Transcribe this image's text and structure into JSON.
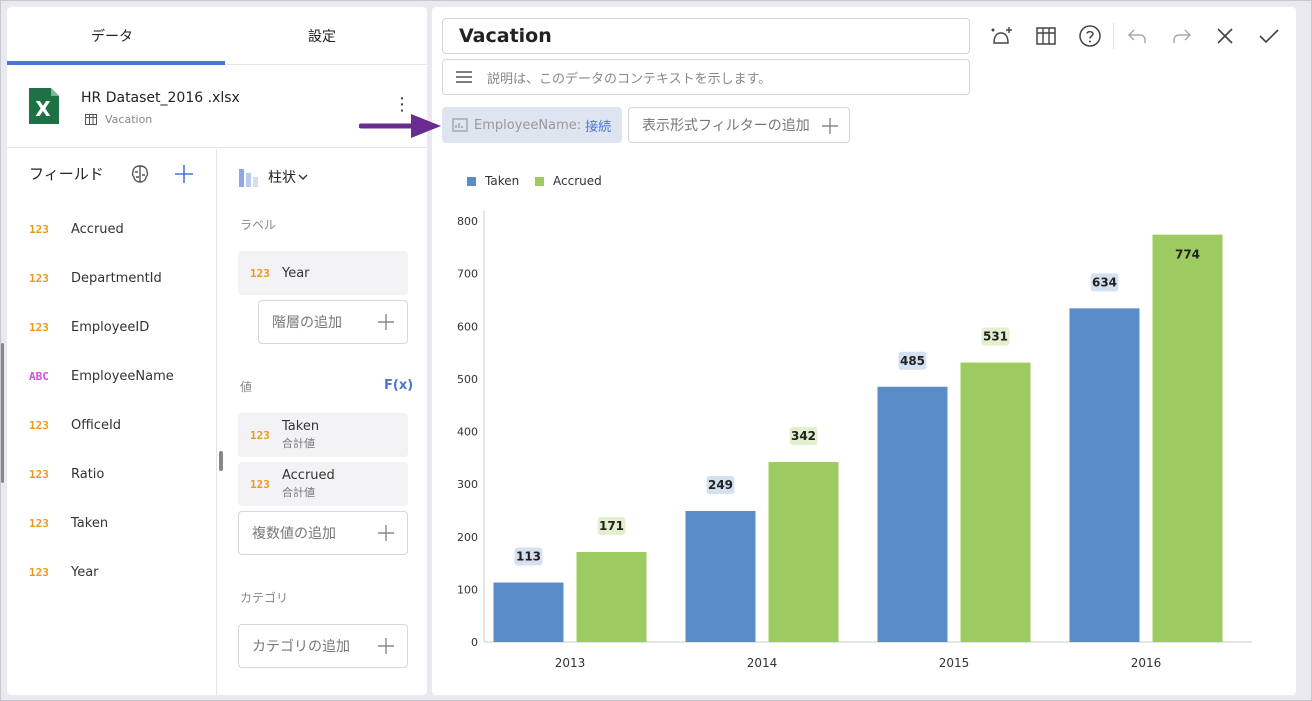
{
  "left_panel": {
    "tabs": [
      {
        "label": "データ"
      },
      {
        "label": "設定"
      }
    ],
    "datasource": {
      "name": "HR Dataset_2016 .xlsx",
      "sheet": "Vacation",
      "icon": "excel-icon",
      "icon_letter": "X",
      "menu": "⋮"
    },
    "fields_title": "フィールド",
    "fields": [
      {
        "type": "123",
        "name": "Accrued"
      },
      {
        "type": "123",
        "name": "DepartmentId"
      },
      {
        "type": "123",
        "name": "EmployeeID"
      },
      {
        "type": "ABC",
        "name": "EmployeeName"
      },
      {
        "type": "123",
        "name": "OfficeId"
      },
      {
        "type": "123",
        "name": "Ratio"
      },
      {
        "type": "123",
        "name": "Taken"
      },
      {
        "type": "123",
        "name": "Year"
      }
    ],
    "chart_type": "柱状",
    "label_section": "ラベル",
    "label_field": {
      "type": "123",
      "name": "Year"
    },
    "add_hierarchy": "階層の追加",
    "value_section": "値",
    "fx": "F(x)",
    "value_fields": [
      {
        "type": "123",
        "name": "Taken",
        "agg": "合計値"
      },
      {
        "type": "123",
        "name": "Accrued",
        "agg": "合計値"
      }
    ],
    "add_values": "複数値の追加",
    "category_section": "カテゴリ",
    "add_category": "カテゴリの追加"
  },
  "right_panel": {
    "title": "Vacation",
    "description_placeholder": "説明は、このデータのコンテキストを示します。",
    "filter_label": "EmployeeName:",
    "filter_value": "接続",
    "add_filter": "表示形式フィルターの追加",
    "toolbar": [
      "ai-icon",
      "grid-icon",
      "help-icon",
      "undo-icon",
      "redo-icon",
      "close-icon",
      "check-icon"
    ]
  },
  "colors": {
    "accent": "#4a75d9",
    "taken": "#5b8cca",
    "accrued": "#9dcb62",
    "arrow": "#6a2c91"
  },
  "chart_data": {
    "type": "bar",
    "categories": [
      "2013",
      "2014",
      "2015",
      "2016"
    ],
    "series": [
      {
        "name": "Taken",
        "values": [
          113,
          249,
          485,
          634
        ]
      },
      {
        "name": "Accrued",
        "values": [
          171,
          342,
          531,
          774
        ]
      }
    ],
    "yticks": [
      "0",
      "100",
      "200",
      "300",
      "400",
      "500",
      "600",
      "700",
      "800"
    ],
    "ylim": [
      0,
      800
    ],
    "legend": "top-left",
    "grid": false
  }
}
